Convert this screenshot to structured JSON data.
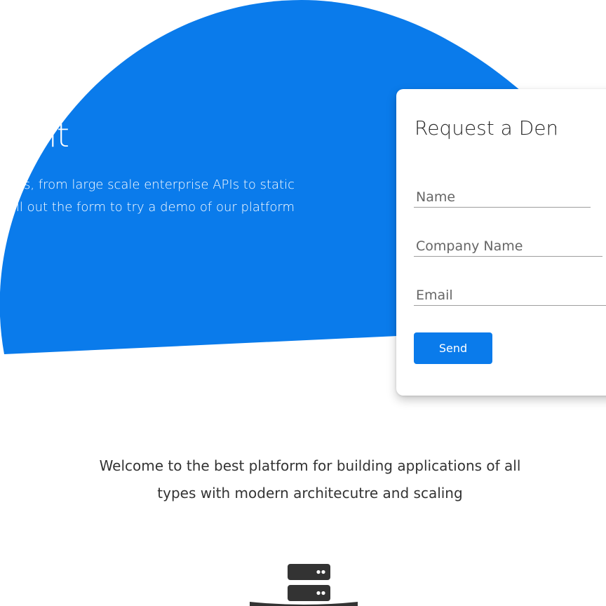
{
  "hero": {
    "title": "Deployment",
    "text_lines": [
      "All your needs, from large scale enterprise APIs to static",
      "Fill out the form to try a demo of our platform"
    ],
    "color": "#0a7beb"
  },
  "demo_form": {
    "title": "Request a Demo",
    "fields": {
      "name_placeholder": "Name",
      "company_placeholder": "Company Name",
      "email_placeholder": "Email"
    },
    "send_label": "Send",
    "button_color": "#0a7beb"
  },
  "welcome": {
    "lines": [
      "Welcome to the best platform for building applications of all",
      "types with modern architecutre and scaling"
    ]
  },
  "feature_icon": "server-icon"
}
